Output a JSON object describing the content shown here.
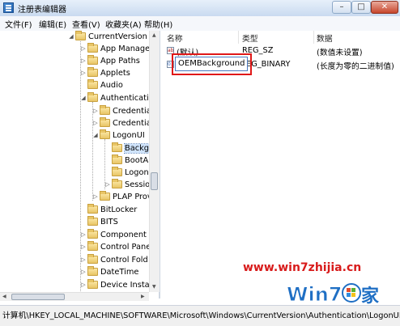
{
  "window": {
    "title": "注册表编辑器"
  },
  "menu": {
    "items": [
      "文件(F)",
      "编辑(E)",
      "查看(V)",
      "收藏夹(A)",
      "帮助(H)"
    ]
  },
  "tree": {
    "nodes": [
      {
        "label": "CurrentVersion"
      },
      {
        "label": "App Manage"
      },
      {
        "label": "App Paths"
      },
      {
        "label": "Applets"
      },
      {
        "label": "Audio"
      },
      {
        "label": "Authenticatio"
      },
      {
        "label": "Credential"
      },
      {
        "label": "Credential"
      },
      {
        "label": "LogonUI"
      },
      {
        "label": "Backgr"
      },
      {
        "label": "BootAr"
      },
      {
        "label": "LogonI"
      },
      {
        "label": "Session"
      },
      {
        "label": "PLAP Prov"
      },
      {
        "label": "BitLocker"
      },
      {
        "label": "BITS"
      },
      {
        "label": "Component E"
      },
      {
        "label": "Control Panel"
      },
      {
        "label": "Control Fold"
      },
      {
        "label": "DateTime"
      },
      {
        "label": "Device Install"
      }
    ]
  },
  "list": {
    "columns": [
      "名称",
      "类型",
      "数据"
    ],
    "rows": [
      {
        "icon": "ab",
        "name": "(默认)",
        "type": "REG_SZ",
        "data": "(数值未设置)"
      },
      {
        "icon": "01",
        "name": "OEMBackground",
        "type": "REG_BINARY",
        "type_visible": "EG_BINARY",
        "data": "(长度为零的二进制值)"
      }
    ],
    "edit_value": "OEMBackground"
  },
  "status": {
    "path": "计算机\\HKEY_LOCAL_MACHINE\\SOFTWARE\\Microsoft\\Windows\\CurrentVersion\\Authentication\\LogonUI\\Ba"
  },
  "watermark": {
    "url": "www.win7zhijia.cn",
    "logo_text": "Win7",
    "logo_suffix": "家"
  },
  "colors": {
    "highlight_box": "#e01818",
    "watermark": "#d81b1b",
    "logo_blue": "#1f6fc4"
  }
}
